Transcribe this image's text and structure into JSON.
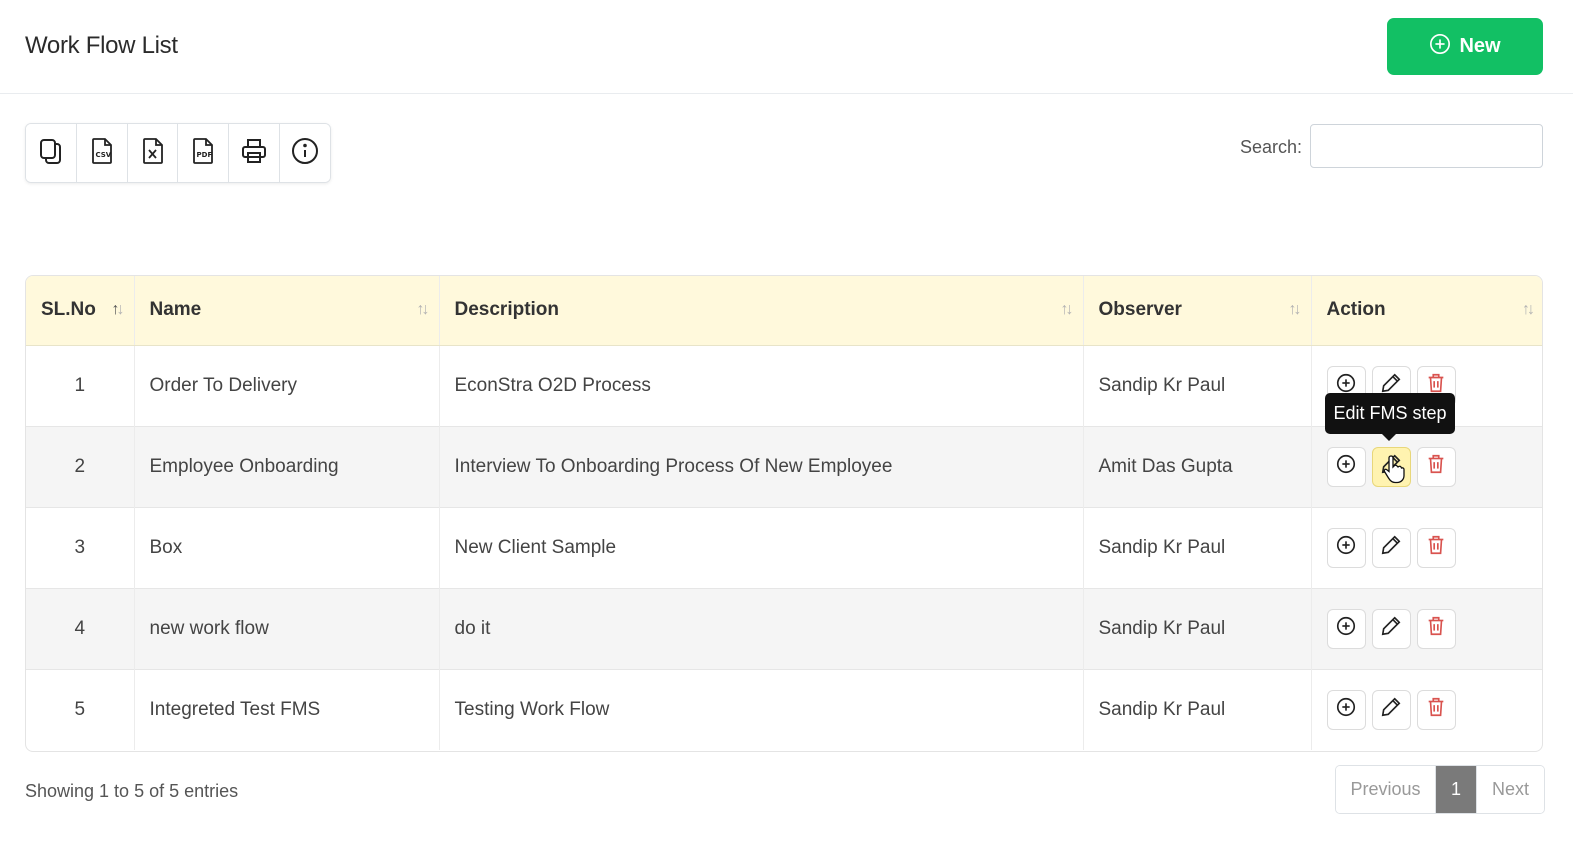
{
  "header": {
    "title": "Work Flow List",
    "new_button_label": "New"
  },
  "toolbar": {
    "buttons": [
      {
        "name": "copy-icon"
      },
      {
        "name": "csv-icon"
      },
      {
        "name": "excel-icon"
      },
      {
        "name": "pdf-icon"
      },
      {
        "name": "print-icon"
      },
      {
        "name": "info-icon"
      }
    ]
  },
  "search": {
    "label": "Search:",
    "value": ""
  },
  "table": {
    "columns": [
      "SL.No",
      "Name",
      "Description",
      "Observer",
      "Action"
    ],
    "rows": [
      {
        "sl": "1",
        "name": "Order To Delivery",
        "description": "EconStra O2D Process",
        "observer": "Sandip Kr Paul"
      },
      {
        "sl": "2",
        "name": "Employee Onboarding",
        "description": "Interview To Onboarding Process Of New Employee",
        "observer": "Amit Das Gupta"
      },
      {
        "sl": "3",
        "name": "Box",
        "description": "New Client Sample",
        "observer": "Sandip Kr Paul"
      },
      {
        "sl": "4",
        "name": "new work flow",
        "description": "do it",
        "observer": "Sandip Kr Paul"
      },
      {
        "sl": "5",
        "name": "Integreted Test FMS",
        "description": "Testing Work Flow",
        "observer": "Sandip Kr Paul"
      }
    ]
  },
  "tooltip": {
    "text": "Edit FMS step"
  },
  "footer": {
    "info": "Showing 1 to 5 of 5 entries",
    "prev_label": "Previous",
    "current_page": "1",
    "next_label": "Next"
  },
  "colors": {
    "accent": "#12c064",
    "header_bg": "#fff9dc",
    "delete": "#d9534f",
    "hover_bg": "#fff3b0"
  }
}
